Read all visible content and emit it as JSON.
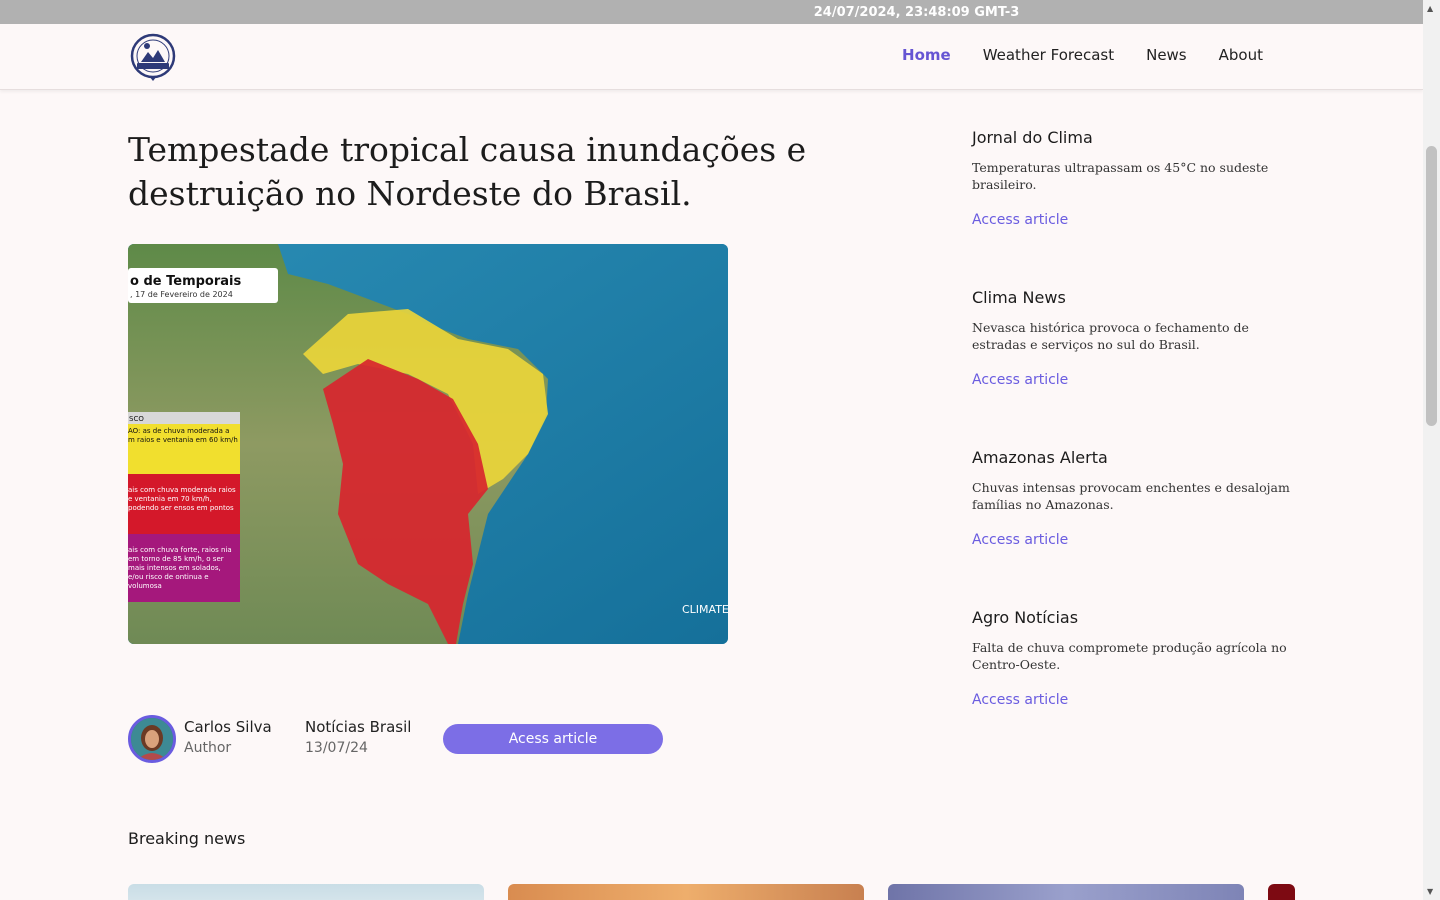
{
  "topbar": {
    "datetime": "24/07/2024, 23:48:09 GMT-3"
  },
  "nav": {
    "logo_text": "WEATHER - TRIP",
    "links": [
      "Home",
      "Weather Forecast",
      "News",
      "About"
    ],
    "active": "Home"
  },
  "article": {
    "headline": "Tempestade tropical causa inundações e destruição no Nordeste do Brasil.",
    "image": {
      "map_title": "o de Temporais",
      "map_date": ", 17 de Fevereiro de 2024",
      "legend_header": "SCO",
      "legend_yellow": "AO: as de chuva moderada a m raios e ventania em 60 km/h",
      "legend_red": "ais com chuva moderada raios e ventania em 70 km/h, podendo ser ensos em pontos",
      "legend_purple": "ais com chuva forte, raios nia em torno de 85 km/h, o ser mais intensos em solados, e/ou risco de ontinua e volumosa",
      "watermark": "CLIMATE"
    },
    "author_name": "Carlos Silva",
    "author_role": "Author",
    "source": "Notícias Brasil",
    "date": "13/07/24",
    "button_label": "Acess article"
  },
  "sidebar": {
    "items": [
      {
        "title": "Jornal do Clima",
        "desc": "Temperaturas ultrapassam os 45°C no sudeste brasileiro.",
        "link": "Access article"
      },
      {
        "title": "Clima News",
        "desc": "Nevasca histórica provoca o fechamento de estradas e serviços no sul do Brasil.",
        "link": "Access article"
      },
      {
        "title": "Amazonas Alerta",
        "desc": "Chuvas intensas provocam enchentes e desalojam famílias no Amazonas.",
        "link": "Access article"
      },
      {
        "title": "Agro Notícias",
        "desc": "Falta de chuva compromete produção agrícola no Centro-Oeste.",
        "link": "Access article"
      }
    ]
  },
  "breaking": {
    "title": "Breaking news"
  },
  "colors": {
    "accent": "#6a5ce0",
    "button": "#7c6ee6",
    "topbar": "#b1b1b1",
    "background": "#fdf8f8"
  }
}
